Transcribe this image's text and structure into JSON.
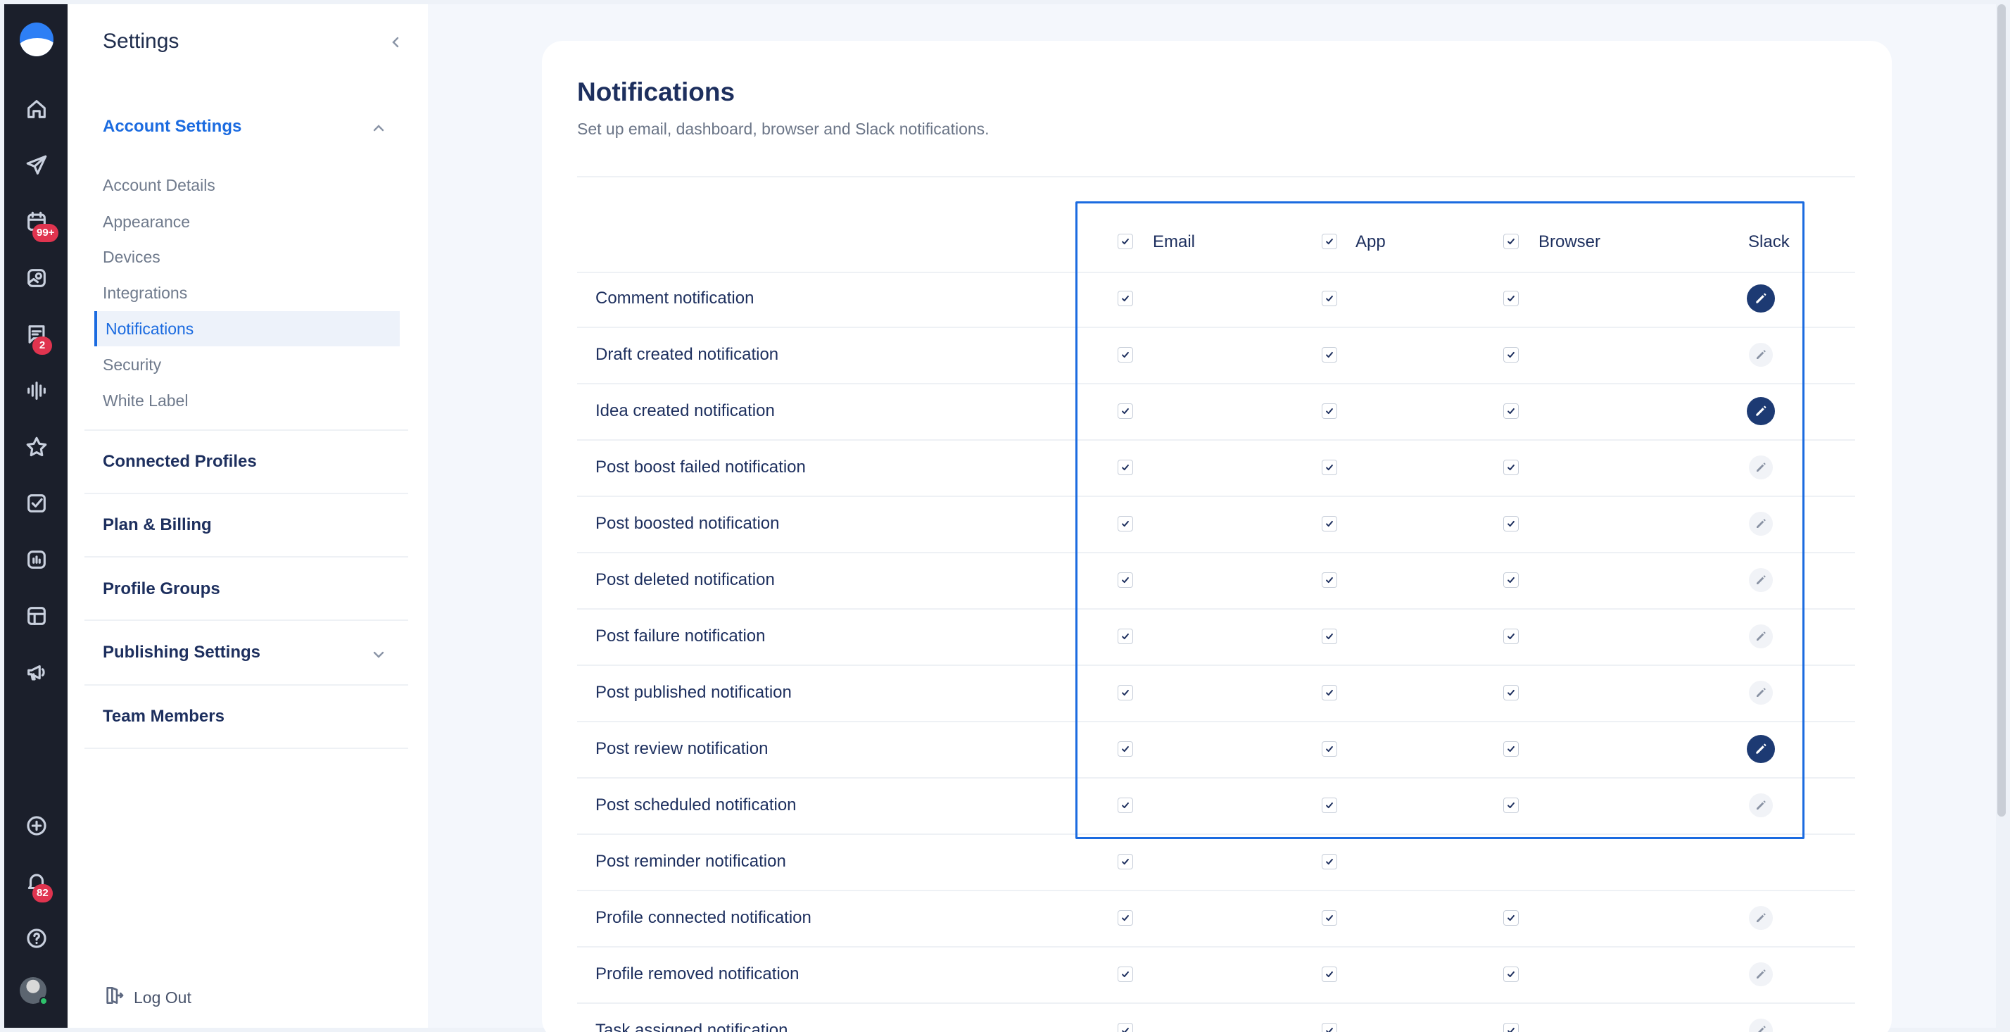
{
  "rail": {
    "badges": {
      "calendar": "99+",
      "messages": "2",
      "notifications": "82"
    },
    "icons": [
      "home-icon",
      "send-icon",
      "calendar-icon",
      "media-icon",
      "messages-icon",
      "audio-icon",
      "star-icon",
      "tasks-icon",
      "analytics-icon",
      "layout-icon",
      "megaphone-icon",
      "add-icon",
      "bell-icon",
      "help-icon"
    ]
  },
  "sidebar": {
    "title": "Settings",
    "sections": [
      {
        "label": "Account Settings",
        "expanded": true
      },
      {
        "label": "Connected Profiles"
      },
      {
        "label": "Plan & Billing"
      },
      {
        "label": "Profile Groups"
      },
      {
        "label": "Publishing Settings",
        "expanded": false
      },
      {
        "label": "Team Members"
      }
    ],
    "sub_items": [
      "Account Details",
      "Appearance",
      "Devices",
      "Integrations",
      "Notifications",
      "Security",
      "White Label"
    ],
    "active_item": "Notifications",
    "logout": "Log Out"
  },
  "main": {
    "title": "Notifications",
    "subtitle": "Set up email, dashboard, browser and Slack notifications.",
    "columns": {
      "email": "Email",
      "app": "App",
      "browser": "Browser",
      "slack": "Slack"
    },
    "rows": [
      {
        "label": "Comment notification",
        "email": true,
        "app": true,
        "browser": true,
        "slack": "active"
      },
      {
        "label": "Draft created notification",
        "email": true,
        "app": true,
        "browser": true,
        "slack": "inactive"
      },
      {
        "label": "Idea created notification",
        "email": true,
        "app": true,
        "browser": true,
        "slack": "active"
      },
      {
        "label": "Post boost failed notification",
        "email": true,
        "app": true,
        "browser": true,
        "slack": "inactive"
      },
      {
        "label": "Post boosted notification",
        "email": true,
        "app": true,
        "browser": true,
        "slack": "inactive"
      },
      {
        "label": "Post deleted notification",
        "email": true,
        "app": true,
        "browser": true,
        "slack": "inactive"
      },
      {
        "label": "Post failure notification",
        "email": true,
        "app": true,
        "browser": true,
        "slack": "inactive"
      },
      {
        "label": "Post published notification",
        "email": true,
        "app": true,
        "browser": true,
        "slack": "inactive"
      },
      {
        "label": "Post review notification",
        "email": true,
        "app": true,
        "browser": true,
        "slack": "active"
      },
      {
        "label": "Post scheduled notification",
        "email": true,
        "app": true,
        "browser": true,
        "slack": "inactive"
      },
      {
        "label": "Post reminder notification",
        "email": true,
        "app": true,
        "browser": false,
        "slack": "none"
      },
      {
        "label": "Profile connected notification",
        "email": true,
        "app": true,
        "browser": true,
        "slack": "inactive"
      },
      {
        "label": "Profile removed notification",
        "email": true,
        "app": true,
        "browser": true,
        "slack": "inactive"
      },
      {
        "label": "Task assigned notification",
        "email": true,
        "app": true,
        "browser": true,
        "slack": "inactive"
      }
    ]
  },
  "colors": {
    "accent": "#1b6be0",
    "rail": "#1b1f2b",
    "slack_active": "#1d3a73",
    "badge": "#e0344f"
  }
}
